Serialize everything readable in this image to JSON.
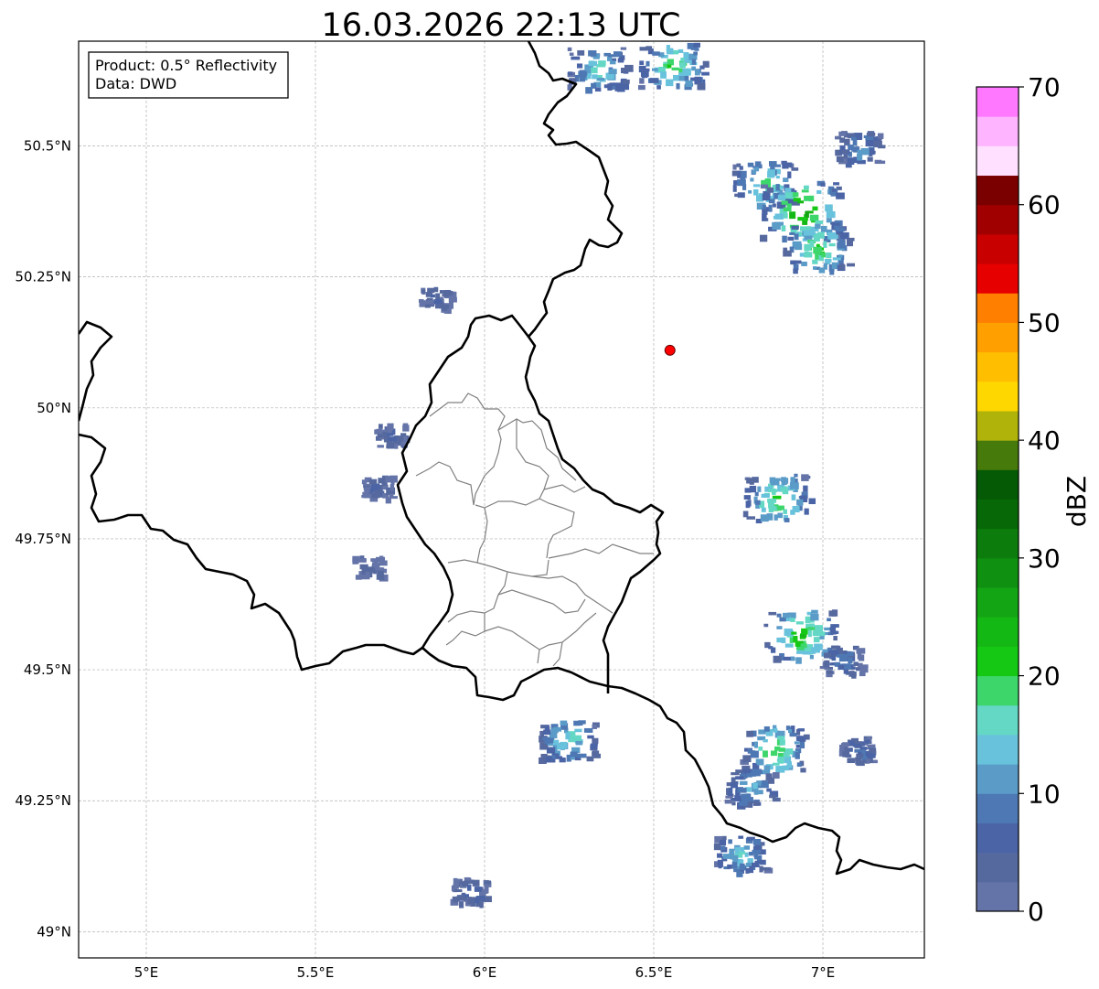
{
  "title": "16.03.2026 22:13 UTC",
  "info_box": {
    "product": "Product: 0.5° Reflectivity",
    "data": "Data: DWD"
  },
  "map": {
    "lon_range": [
      4.8,
      7.3
    ],
    "lat_range": [
      48.95,
      50.7
    ],
    "lon_ticks": [
      {
        "value": 5.0,
        "label": "5°E"
      },
      {
        "value": 5.5,
        "label": "5.5°E"
      },
      {
        "value": 6.0,
        "label": "6°E"
      },
      {
        "value": 6.5,
        "label": "6.5°E"
      },
      {
        "value": 7.0,
        "label": "7°E"
      }
    ],
    "lat_ticks": [
      {
        "value": 49.0,
        "label": "49°N"
      },
      {
        "value": 49.25,
        "label": "49.25°N"
      },
      {
        "value": 49.5,
        "label": "49.5°N"
      },
      {
        "value": 49.75,
        "label": "49.75°N"
      },
      {
        "value": 50.0,
        "label": "50°N"
      },
      {
        "value": 50.25,
        "label": "50.25°N"
      },
      {
        "value": 50.5,
        "label": "50.5°N"
      }
    ],
    "gridlines": true,
    "radar_site": {
      "lon": 6.548,
      "lat": 50.11,
      "color": "#ff0000"
    },
    "echo_cells": [
      {
        "lon": 6.33,
        "lat": 50.65,
        "dbz": 18
      },
      {
        "lon": 6.55,
        "lat": 50.66,
        "dbz": 22
      },
      {
        "lon": 6.82,
        "lat": 50.43,
        "dbz": 20
      },
      {
        "lon": 6.93,
        "lat": 50.38,
        "dbz": 28
      },
      {
        "lon": 6.98,
        "lat": 50.31,
        "dbz": 22
      },
      {
        "lon": 7.1,
        "lat": 50.5,
        "dbz": 12
      },
      {
        "lon": 5.85,
        "lat": 50.21,
        "dbz": 6
      },
      {
        "lon": 5.72,
        "lat": 49.95,
        "dbz": 6
      },
      {
        "lon": 5.68,
        "lat": 49.85,
        "dbz": 6
      },
      {
        "lon": 5.65,
        "lat": 49.7,
        "dbz": 5
      },
      {
        "lon": 6.86,
        "lat": 49.83,
        "dbz": 22
      },
      {
        "lon": 6.93,
        "lat": 49.57,
        "dbz": 24
      },
      {
        "lon": 7.05,
        "lat": 49.52,
        "dbz": 10
      },
      {
        "lon": 6.85,
        "lat": 49.35,
        "dbz": 22
      },
      {
        "lon": 6.78,
        "lat": 49.28,
        "dbz": 14
      },
      {
        "lon": 7.1,
        "lat": 49.35,
        "dbz": 8
      },
      {
        "lon": 6.75,
        "lat": 49.15,
        "dbz": 16
      },
      {
        "lon": 6.24,
        "lat": 49.37,
        "dbz": 18
      },
      {
        "lon": 5.95,
        "lat": 49.08,
        "dbz": 8
      }
    ]
  },
  "colorbar": {
    "label": "dBZ",
    "range": [
      0,
      70
    ],
    "step": 2.5,
    "ticks": [
      {
        "value": 0,
        "label": "0"
      },
      {
        "value": 10,
        "label": "10"
      },
      {
        "value": 20,
        "label": "20"
      },
      {
        "value": 30,
        "label": "30"
      },
      {
        "value": 40,
        "label": "40"
      },
      {
        "value": 50,
        "label": "50"
      },
      {
        "value": 60,
        "label": "60"
      },
      {
        "value": 70,
        "label": "70"
      }
    ],
    "colors": [
      "#6474a8",
      "#56699f",
      "#4a64a6",
      "#4e78b3",
      "#5a9bc8",
      "#68c2dc",
      "#64d7c5",
      "#3dd66b",
      "#14c814",
      "#14b814",
      "#14a514",
      "#109010",
      "#0c7d0c",
      "#076807",
      "#055a05",
      "#467a0a",
      "#b0b40a",
      "#ffd700",
      "#ffbe00",
      "#ffa000",
      "#ff8000",
      "#e60000",
      "#c80000",
      "#a00000",
      "#7a0000",
      "#ffe0ff",
      "#ffb4ff",
      "#ff78ff",
      "#ec3cec"
    ]
  }
}
